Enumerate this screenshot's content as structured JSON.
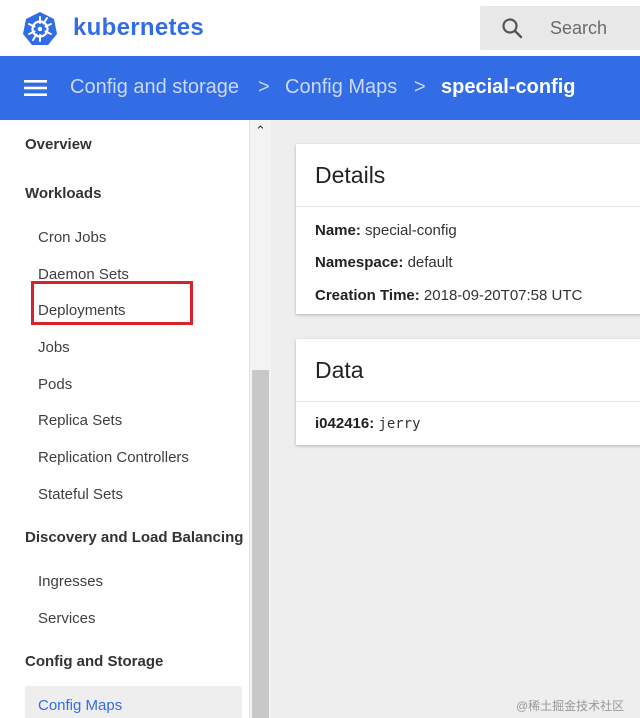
{
  "header": {
    "brand": "kubernetes",
    "search_placeholder": "Search"
  },
  "breadcrumb": {
    "items": [
      "Config and storage",
      "Config Maps",
      "special-config"
    ],
    "separator": ">"
  },
  "sidebar": {
    "overview": "Overview",
    "workloads": {
      "title": "Workloads",
      "items": [
        "Cron Jobs",
        "Daemon Sets",
        "Deployments",
        "Jobs",
        "Pods",
        "Replica Sets",
        "Replication Controllers",
        "Stateful Sets"
      ]
    },
    "discovery": {
      "title": "Discovery and Load Balancing",
      "items": [
        "Ingresses",
        "Services"
      ]
    },
    "config": {
      "title": "Config and Storage",
      "items": [
        "Config Maps"
      ],
      "active": "Config Maps"
    }
  },
  "details": {
    "title": "Details",
    "rows": [
      {
        "key": "Name:",
        "value": "special-config"
      },
      {
        "key": "Namespace:",
        "value": "default"
      },
      {
        "key": "Creation Time:",
        "value": "2018-09-20T07:58 UTC"
      }
    ]
  },
  "data_card": {
    "title": "Data",
    "entries": [
      {
        "key": "i042416:",
        "value": "jerry"
      }
    ]
  },
  "watermark": "@稀土掘金技术社区",
  "colors": {
    "brand_blue": "#326de6",
    "highlight_red": "#d8232a"
  },
  "icons": [
    "kubernetes-logo-icon",
    "search-icon",
    "hamburger-menu-icon",
    "chevron-up-icon"
  ]
}
